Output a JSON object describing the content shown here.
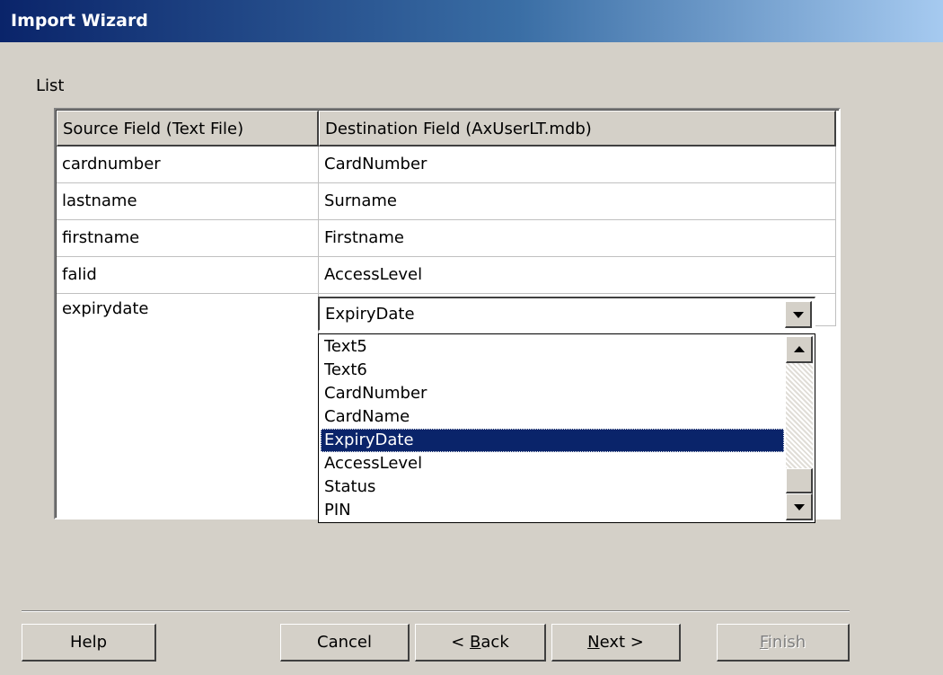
{
  "window": {
    "title": "Import Wizard"
  },
  "group": {
    "label": "List"
  },
  "grid": {
    "headers": [
      "Source Field (Text File)",
      "Destination Field (AxUserLT.mdb)"
    ],
    "rows": [
      {
        "source": "cardnumber",
        "destination": "CardNumber"
      },
      {
        "source": "lastname",
        "destination": "Surname"
      },
      {
        "source": "firstname",
        "destination": "Firstname"
      },
      {
        "source": "falid",
        "destination": "AccessLevel"
      },
      {
        "source": "expirydate",
        "destination": "ExpiryDate"
      }
    ]
  },
  "combo": {
    "value": "ExpiryDate",
    "options": [
      "Text5",
      "Text6",
      "CardNumber",
      "CardName",
      "ExpiryDate",
      "AccessLevel",
      "Status",
      "PIN"
    ],
    "selected": "ExpiryDate"
  },
  "buttons": {
    "help": "Help",
    "cancel": "Cancel",
    "back_prefix": "< ",
    "back_mnemonic": "B",
    "back_rest": "ack",
    "next_mnemonic": "N",
    "next_rest": "ext >",
    "finish_mnemonic": "F",
    "finish_rest": "inish",
    "finish_enabled": false
  },
  "colors": {
    "window_bg": "#d4d0c8",
    "selection": "#0a246a",
    "title_gradient_start": "#0a246a",
    "title_gradient_end": "#a6caf0"
  }
}
